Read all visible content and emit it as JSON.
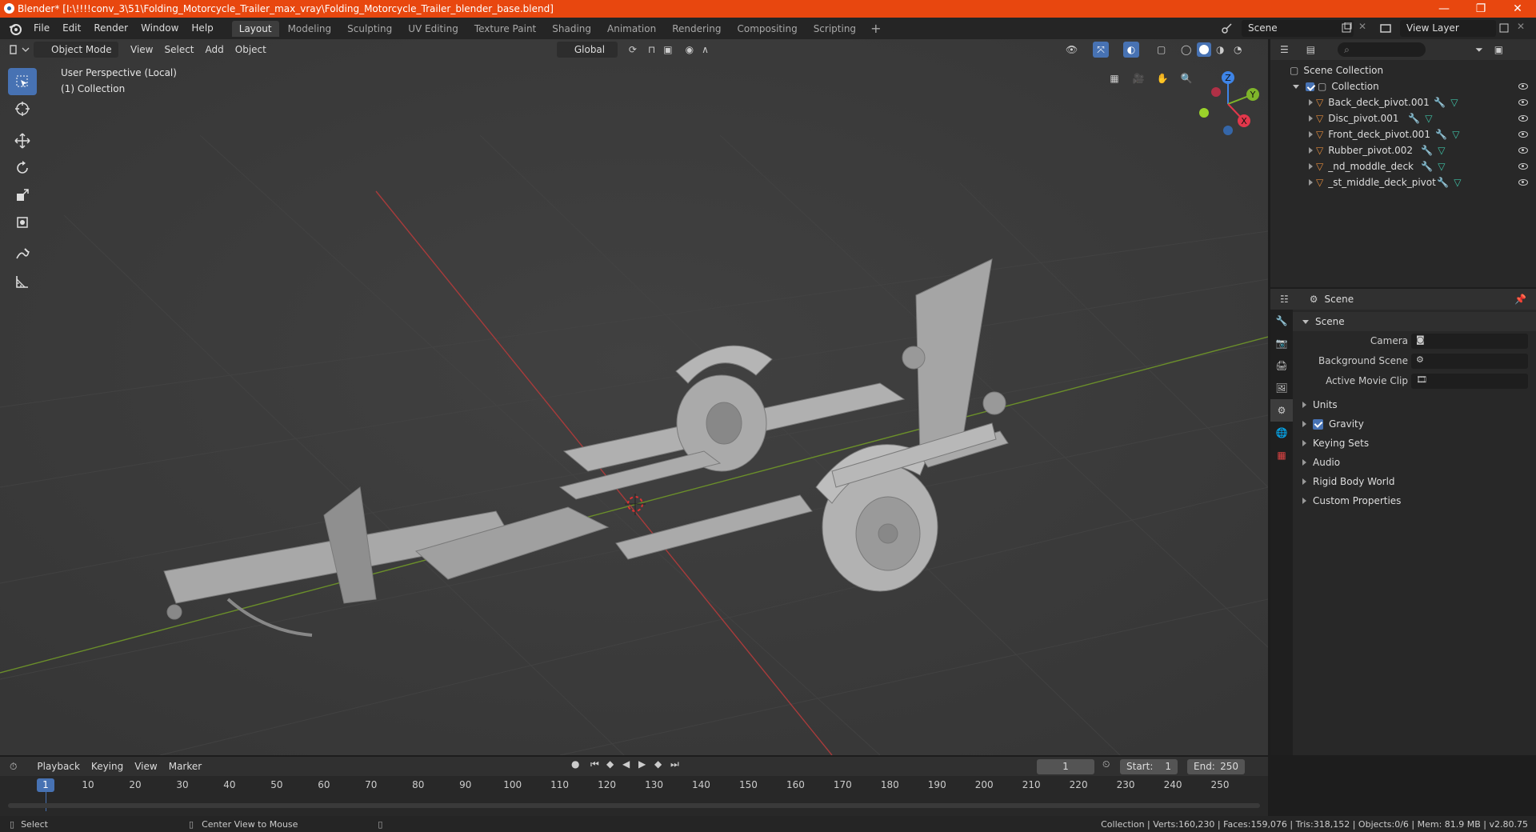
{
  "window": {
    "title": "Blender* [I:\\!!!!conv_3\\51\\Folding_Motorcycle_Trailer_max_vray\\Folding_Motorcycle_Trailer_blender_base.blend]",
    "minimize": "—",
    "maximize": "❐",
    "close": "✕"
  },
  "menu": [
    "File",
    "Edit",
    "Render",
    "Window",
    "Help"
  ],
  "workspaces": [
    "Layout",
    "Modeling",
    "Sculpting",
    "UV Editing",
    "Texture Paint",
    "Shading",
    "Animation",
    "Rendering",
    "Compositing",
    "Scripting"
  ],
  "active_workspace": "Layout",
  "workspace_add": "+",
  "scene_name": "Scene",
  "view_layer_name": "View Layer",
  "viewport": {
    "mode": "Object Mode",
    "menus": [
      "View",
      "Select",
      "Add",
      "Object"
    ],
    "transform_orientation": "Global",
    "info_line1": "User Perspective (Local)",
    "info_line2": "(1) Collection",
    "gizmo_axes": {
      "z": "Z",
      "y": "Y",
      "x": "X"
    }
  },
  "outliner": {
    "root": "Scene Collection",
    "collection": "Collection",
    "items": [
      "Back_deck_pivot.001",
      "Disc_pivot.001",
      "Front_deck_pivot.001",
      "Rubber_pivot.002",
      "_nd_moddle_deck",
      "_st_middle_deck_pivot"
    ]
  },
  "properties": {
    "header": "Scene",
    "panel": "Scene",
    "fields": [
      {
        "label": "Camera"
      },
      {
        "label": "Background Scene"
      },
      {
        "label": "Active Movie Clip"
      }
    ],
    "sections": [
      "Units",
      "Gravity",
      "Keying Sets",
      "Audio",
      "Rigid Body World",
      "Custom Properties"
    ]
  },
  "timeline": {
    "menus": [
      "Playback",
      "Keying",
      "View",
      "Marker"
    ],
    "current_frame": "1",
    "start_label": "Start:",
    "start": "1",
    "end_label": "End:",
    "end": "250",
    "ruler": [
      "1",
      "10",
      "20",
      "30",
      "40",
      "50",
      "60",
      "70",
      "80",
      "90",
      "100",
      "110",
      "120",
      "130",
      "140",
      "150",
      "160",
      "170",
      "180",
      "190",
      "200",
      "210",
      "220",
      "230",
      "240",
      "250"
    ]
  },
  "statusbar": {
    "left": "Select",
    "middle": "Center View to Mouse",
    "right": "Collection | Verts:160,230 | Faces:159,076 | Tris:318,152 | Objects:0/6 | Mem: 81.9 MB | v2.80.75"
  },
  "colors": {
    "accent": "#4772b3",
    "titlebar": "#e8470f",
    "x_axis": "#e2374b",
    "y_axis": "#7fb52a",
    "z_axis": "#3e84e6"
  }
}
